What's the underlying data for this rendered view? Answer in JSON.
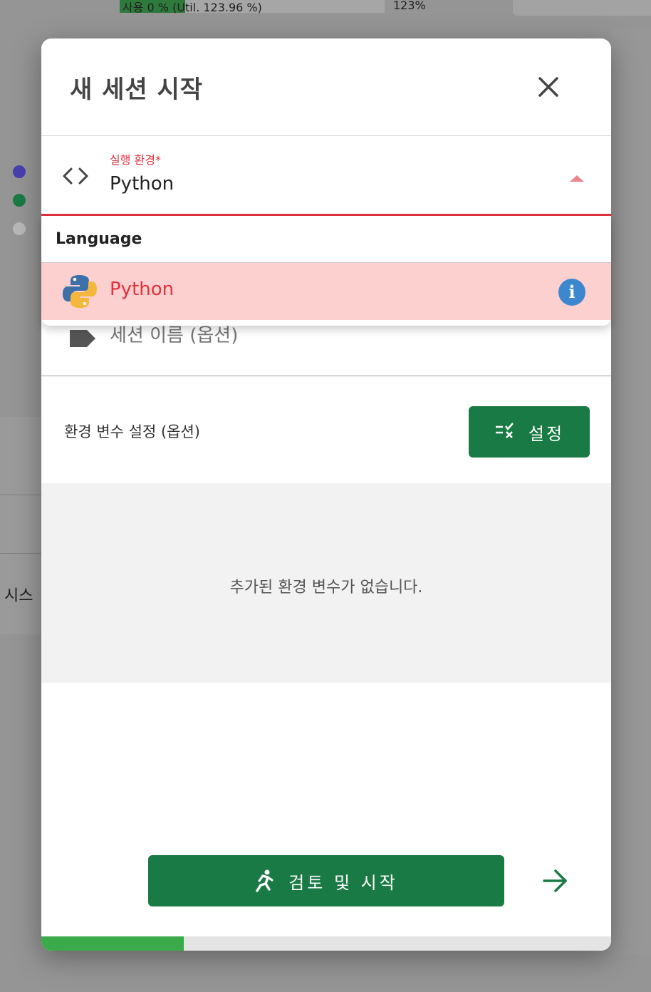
{
  "background": {
    "progress_text": "사용 0 % (Util. 123.96 %)",
    "percent": "123%",
    "side_text": "시스"
  },
  "dialog": {
    "title": "새 세션 시작",
    "close_icon": "close-icon"
  },
  "env_field": {
    "label": "실행 환경*",
    "value": "Python",
    "icon": "code-icon"
  },
  "dropdown": {
    "group_label": "Language",
    "items": [
      {
        "label": "Python",
        "icon": "python-logo",
        "info_icon": "info-icon"
      }
    ]
  },
  "session_name": {
    "placeholder": "세션 이름 (옵션)",
    "icon": "tag-icon"
  },
  "env_vars": {
    "label": "환경 변수 설정 (옵션)",
    "setting_button": "설정",
    "empty_text": "추가된 환경 변수가 없습니다."
  },
  "footer": {
    "start_button": "검토 및 시작",
    "next_icon": "arrow-right-icon",
    "progress": 0.25
  },
  "colors": {
    "accent_green": "#1a7a45",
    "error_red": "#e0323c",
    "progress_green": "#3aaa4a",
    "highlight": "#fdd0d0"
  }
}
